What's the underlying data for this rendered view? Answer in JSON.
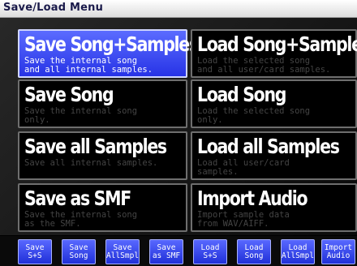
{
  "window": {
    "title": "Save/Load Menu"
  },
  "colors": {
    "active_tile": "#3a4cff",
    "button": "#3a4cff",
    "tile_border": "#6e6e6e",
    "text": "#ffffff",
    "dim_text": "#444444"
  },
  "tiles": [
    {
      "label": "Save Song+Samples",
      "description": "Save the internal song\nand all internal samples.",
      "active": true
    },
    {
      "label": "Load Song+Samples",
      "description": "Load the selected song\nand all user/card samples.",
      "active": false
    },
    {
      "label": "Save Song",
      "description": "Save the internal song\nonly.",
      "active": false
    },
    {
      "label": "Load Song",
      "description": "Load the selected song\nonly.",
      "active": false
    },
    {
      "label": "Save all Samples",
      "description": "Save all internal samples.",
      "active": false
    },
    {
      "label": "Load all Samples",
      "description": "Load all user/card\nsamples.",
      "active": false
    },
    {
      "label": "Save as SMF",
      "description": "Save the internal song\nas the SMF.",
      "active": false
    },
    {
      "label": "Import Audio",
      "description": "Import sample data\nfrom WAV/AIFF.",
      "active": false
    }
  ],
  "buttons": [
    {
      "label": "Save\nS+S"
    },
    {
      "label": "Save\nSong"
    },
    {
      "label": "Save\nAllSmpl"
    },
    {
      "label": "Save\nas SMF"
    },
    {
      "label": "Load\nS+S"
    },
    {
      "label": "Load\nSong"
    },
    {
      "label": "Load\nAllSmpl"
    },
    {
      "label": "Import\nAudio"
    }
  ]
}
